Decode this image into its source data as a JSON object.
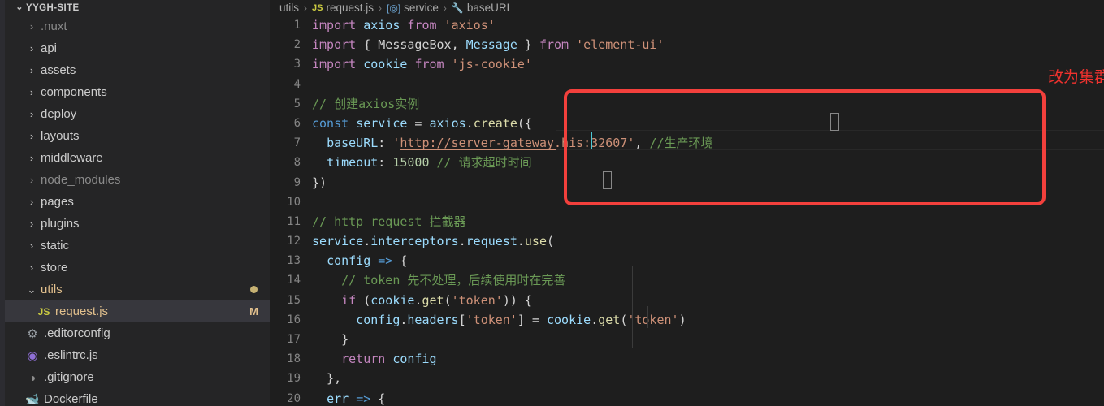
{
  "sidebar": {
    "header": {
      "label": "YYGH-SITE",
      "twisty": "chevron-down-icon"
    },
    "items": [
      {
        "kind": "folder",
        "twisty": "›",
        "label": ".nuxt",
        "state": "dim",
        "indent": 1
      },
      {
        "kind": "folder",
        "twisty": "›",
        "label": "api",
        "state": "normal",
        "indent": 1
      },
      {
        "kind": "folder",
        "twisty": "›",
        "label": "assets",
        "state": "normal",
        "indent": 1
      },
      {
        "kind": "folder",
        "twisty": "›",
        "label": "components",
        "state": "normal",
        "indent": 1
      },
      {
        "kind": "folder",
        "twisty": "›",
        "label": "deploy",
        "state": "normal",
        "indent": 1
      },
      {
        "kind": "folder",
        "twisty": "›",
        "label": "layouts",
        "state": "normal",
        "indent": 1
      },
      {
        "kind": "folder",
        "twisty": "›",
        "label": "middleware",
        "state": "normal",
        "indent": 1
      },
      {
        "kind": "folder",
        "twisty": "›",
        "label": "node_modules",
        "state": "dim",
        "indent": 1
      },
      {
        "kind": "folder",
        "twisty": "›",
        "label": "pages",
        "state": "normal",
        "indent": 1
      },
      {
        "kind": "folder",
        "twisty": "›",
        "label": "plugins",
        "state": "normal",
        "indent": 1
      },
      {
        "kind": "folder",
        "twisty": "›",
        "label": "static",
        "state": "normal",
        "indent": 1
      },
      {
        "kind": "folder",
        "twisty": "›",
        "label": "store",
        "state": "normal",
        "indent": 1
      },
      {
        "kind": "folder",
        "twisty": "⌄",
        "label": "utils",
        "state": "modified",
        "indent": 1,
        "dot": true
      }
    ],
    "selected_file": {
      "icon": "js-file-icon",
      "icon_text": "JS",
      "label": "request.js",
      "badge": "M"
    },
    "root_files": [
      {
        "icon": "gear-icon",
        "glyph": "⚙",
        "label": ".editorconfig",
        "color": "gear"
      },
      {
        "icon": "eslint-icon",
        "glyph": "◉",
        "label": ".eslintrc.js",
        "color": "eslint"
      },
      {
        "icon": "git-icon",
        "glyph": "◑",
        "label": ".gitignore",
        "color": "git"
      },
      {
        "icon": "docker-icon",
        "glyph": "ὀb",
        "label": "Dockerfile",
        "color": "docker"
      }
    ]
  },
  "breadcrumb": {
    "items": [
      {
        "label": "utils",
        "icon": null
      },
      {
        "label": "request.js",
        "icon": "js-file-icon",
        "icon_text": "JS"
      },
      {
        "label": "service",
        "icon": "field-icon",
        "icon_text": "[◎]"
      },
      {
        "label": "baseURL",
        "icon": "property-icon",
        "icon_text": "ὒ7"
      }
    ],
    "separator": "›"
  },
  "editor": {
    "file": "request.js",
    "language": "javascript",
    "cursor_line": 7,
    "lines": [
      {
        "n": "1",
        "tokens": [
          {
            "t": "import",
            "c": "k-import"
          },
          {
            "t": " ",
            "c": "punc"
          },
          {
            "t": "axios",
            "c": "var"
          },
          {
            "t": " ",
            "c": "punc"
          },
          {
            "t": "from",
            "c": "k-import"
          },
          {
            "t": " ",
            "c": "punc"
          },
          {
            "t": "'axios'",
            "c": "str"
          }
        ]
      },
      {
        "n": "2",
        "tokens": [
          {
            "t": "import",
            "c": "k-import"
          },
          {
            "t": " { ",
            "c": "punc"
          },
          {
            "t": "MessageBox",
            "c": "varsoft"
          },
          {
            "t": ", ",
            "c": "punc"
          },
          {
            "t": "Message",
            "c": "var"
          },
          {
            "t": " } ",
            "c": "punc"
          },
          {
            "t": "from",
            "c": "k-import"
          },
          {
            "t": " ",
            "c": "punc"
          },
          {
            "t": "'element-ui'",
            "c": "str"
          }
        ]
      },
      {
        "n": "3",
        "tokens": [
          {
            "t": "import",
            "c": "k-import"
          },
          {
            "t": " ",
            "c": "punc"
          },
          {
            "t": "cookie",
            "c": "var"
          },
          {
            "t": " ",
            "c": "punc"
          },
          {
            "t": "from",
            "c": "k-import"
          },
          {
            "t": " ",
            "c": "punc"
          },
          {
            "t": "'js-cookie'",
            "c": "str"
          }
        ]
      },
      {
        "n": "4",
        "tokens": []
      },
      {
        "n": "5",
        "tokens": [
          {
            "t": "// 创建axios实例",
            "c": "cmt"
          }
        ]
      },
      {
        "n": "6",
        "tokens": [
          {
            "t": "const",
            "c": "k-const"
          },
          {
            "t": " ",
            "c": "punc"
          },
          {
            "t": "service",
            "c": "var"
          },
          {
            "t": " = ",
            "c": "punc"
          },
          {
            "t": "axios",
            "c": "var"
          },
          {
            "t": ".",
            "c": "punc"
          },
          {
            "t": "create",
            "c": "fn"
          },
          {
            "t": "({",
            "c": "punc"
          }
        ]
      },
      {
        "n": "7",
        "tokens": [
          {
            "t": "  ",
            "c": "punc"
          },
          {
            "t": "baseURL",
            "c": "var"
          },
          {
            "t": ": ",
            "c": "punc"
          },
          {
            "t": "'",
            "c": "str"
          },
          {
            "t": "http://server-gateway.his:32607",
            "c": "link"
          },
          {
            "t": "'",
            "c": "str"
          },
          {
            "t": ", ",
            "c": "punc"
          },
          {
            "t": "//生产环境",
            "c": "cmt"
          }
        ]
      },
      {
        "n": "8",
        "tokens": [
          {
            "t": "  ",
            "c": "punc"
          },
          {
            "t": "timeout",
            "c": "var"
          },
          {
            "t": ": ",
            "c": "punc"
          },
          {
            "t": "15000",
            "c": "num"
          },
          {
            "t": " ",
            "c": "punc"
          },
          {
            "t": "// 请求超时时间",
            "c": "cmt"
          }
        ]
      },
      {
        "n": "9",
        "tokens": [
          {
            "t": "})",
            "c": "punc"
          }
        ]
      },
      {
        "n": "10",
        "tokens": []
      },
      {
        "n": "11",
        "tokens": [
          {
            "t": "// http request 拦截器",
            "c": "cmt"
          }
        ]
      },
      {
        "n": "12",
        "tokens": [
          {
            "t": "service",
            "c": "var"
          },
          {
            "t": ".",
            "c": "punc"
          },
          {
            "t": "interceptors",
            "c": "var"
          },
          {
            "t": ".",
            "c": "punc"
          },
          {
            "t": "request",
            "c": "var"
          },
          {
            "t": ".",
            "c": "punc"
          },
          {
            "t": "use",
            "c": "fn"
          },
          {
            "t": "(",
            "c": "punc"
          }
        ]
      },
      {
        "n": "13",
        "tokens": [
          {
            "t": "  ",
            "c": "punc"
          },
          {
            "t": "config",
            "c": "var"
          },
          {
            "t": " ",
            "c": "punc"
          },
          {
            "t": "=>",
            "c": "arrow"
          },
          {
            "t": " {",
            "c": "punc"
          }
        ]
      },
      {
        "n": "14",
        "tokens": [
          {
            "t": "    ",
            "c": "punc"
          },
          {
            "t": "// token 先不处理，后续使用时在完善",
            "c": "cmt"
          }
        ]
      },
      {
        "n": "15",
        "tokens": [
          {
            "t": "    ",
            "c": "punc"
          },
          {
            "t": "if",
            "c": "ctrl"
          },
          {
            "t": " (",
            "c": "punc"
          },
          {
            "t": "cookie",
            "c": "var"
          },
          {
            "t": ".",
            "c": "punc"
          },
          {
            "t": "get",
            "c": "fn"
          },
          {
            "t": "(",
            "c": "punc"
          },
          {
            "t": "'token'",
            "c": "str"
          },
          {
            "t": ")) {",
            "c": "punc"
          }
        ]
      },
      {
        "n": "16",
        "tokens": [
          {
            "t": "      ",
            "c": "punc"
          },
          {
            "t": "config",
            "c": "var"
          },
          {
            "t": ".",
            "c": "punc"
          },
          {
            "t": "headers",
            "c": "var"
          },
          {
            "t": "[",
            "c": "punc"
          },
          {
            "t": "'token'",
            "c": "str"
          },
          {
            "t": "] = ",
            "c": "punc"
          },
          {
            "t": "cookie",
            "c": "var"
          },
          {
            "t": ".",
            "c": "punc"
          },
          {
            "t": "get",
            "c": "fn"
          },
          {
            "t": "(",
            "c": "punc"
          },
          {
            "t": "'token'",
            "c": "str"
          },
          {
            "t": ")",
            "c": "punc"
          }
        ]
      },
      {
        "n": "17",
        "tokens": [
          {
            "t": "    }",
            "c": "punc"
          }
        ]
      },
      {
        "n": "18",
        "tokens": [
          {
            "t": "    ",
            "c": "punc"
          },
          {
            "t": "return",
            "c": "ctrl"
          },
          {
            "t": " ",
            "c": "punc"
          },
          {
            "t": "config",
            "c": "var"
          }
        ]
      },
      {
        "n": "19",
        "tokens": [
          {
            "t": "  },",
            "c": "punc"
          }
        ]
      },
      {
        "n": "20",
        "tokens": [
          {
            "t": "  ",
            "c": "punc"
          },
          {
            "t": "err",
            "c": "var"
          },
          {
            "t": " ",
            "c": "punc"
          },
          {
            "t": "=>",
            "c": "arrow"
          },
          {
            "t": " {",
            "c": "punc"
          }
        ]
      }
    ]
  },
  "annotation": {
    "text": "改为集群内的网关地址",
    "color": "#f0322e",
    "box_color": "#f2403c"
  },
  "colors": {
    "editor_bg": "#1e1e1e",
    "sidebar_bg": "#252526",
    "selection_bg": "#37373d",
    "modified_fg": "#e2c08d",
    "annotation_red": "#f2403c",
    "cursor": "#4ec9d6"
  }
}
